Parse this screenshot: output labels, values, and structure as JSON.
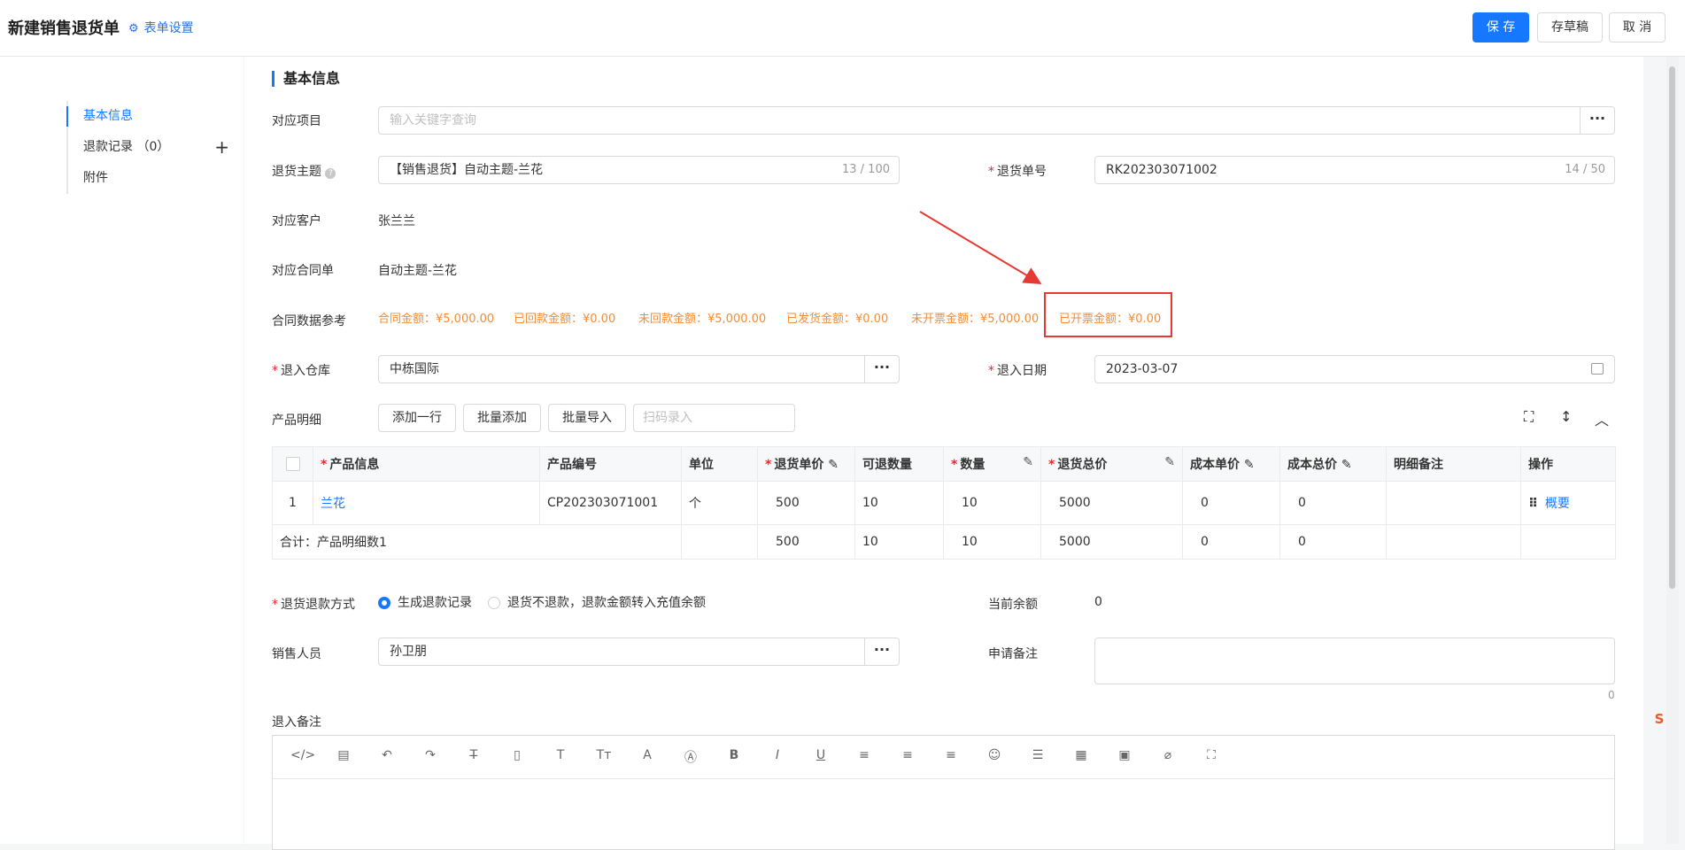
{
  "header": {
    "title": "新建销售退货单",
    "form_settings": "表单设置",
    "save": "保 存",
    "draft": "存草稿",
    "cancel": "取 消"
  },
  "sidebar": {
    "items": [
      {
        "label": "基本信息"
      },
      {
        "label": "退款记录 （0）"
      },
      {
        "label": "附件"
      }
    ],
    "plus": "+"
  },
  "section_title": "基本信息",
  "fields": {
    "project": {
      "label": "对应项目",
      "placeholder": "输入关键字查询",
      "dots": "···"
    },
    "subject": {
      "label": "退货主题",
      "value": "【销售退货】自动主题-兰花",
      "counter": "13 / 100"
    },
    "order_no": {
      "label": "退货单号",
      "value": "RK202303071002",
      "counter": "14 / 50"
    },
    "customer": {
      "label": "对应客户",
      "value": "张兰兰"
    },
    "contract": {
      "label": "对应合同单",
      "value": "自动主题-兰花"
    },
    "contract_ref": {
      "label": "合同数据参考",
      "items": [
        "合同金额：¥5,000.00",
        "已回款金额：¥0.00",
        "未回款金额：¥5,000.00",
        "已发货金额：¥0.00",
        "未开票金额：¥5,000.00",
        "已开票金额：¥0.00"
      ]
    },
    "warehouse": {
      "label": "退入仓库",
      "value": "中栋国际",
      "dots": "···"
    },
    "date": {
      "label": "退入日期",
      "value": "2023-03-07"
    },
    "product_detail": {
      "label": "产品明细"
    },
    "refund_method": {
      "label": "退货退款方式",
      "options": [
        "生成退款记录",
        "退货不退款，退款金额转入充值余额"
      ],
      "selected": 0
    },
    "balance": {
      "label": "当前余额",
      "value": "0"
    },
    "sales": {
      "label": "销售人员",
      "value": "孙卫朋",
      "dots": "···"
    },
    "apply_note": {
      "label": "申请备注",
      "counter": "0"
    },
    "return_note": {
      "label": "退入备注"
    }
  },
  "product_toolbar": {
    "add_row": "添加一行",
    "batch_add": "批量添加",
    "batch_import": "批量导入",
    "scan_placeholder": "扫码录入"
  },
  "table": {
    "headers": [
      "",
      "产品信息",
      "产品编号",
      "单位",
      "退货单价",
      "可退数量",
      "数量",
      "退货总价",
      "成本单价",
      "成本总价",
      "明细备注",
      "操作"
    ],
    "rows": [
      [
        "1",
        "兰花",
        "CP202303071001",
        "个",
        "500",
        "10",
        "10",
        "5000",
        "0",
        "0",
        "",
        "概要"
      ]
    ],
    "summary": [
      "合计：产品明细数1",
      "",
      "",
      "500",
      "10",
      "10",
      "5000",
      "0",
      "0",
      "",
      ""
    ]
  },
  "colors": {
    "primary": "#1677ff",
    "orange": "#f28c38",
    "annotation_red": "#e53935"
  }
}
